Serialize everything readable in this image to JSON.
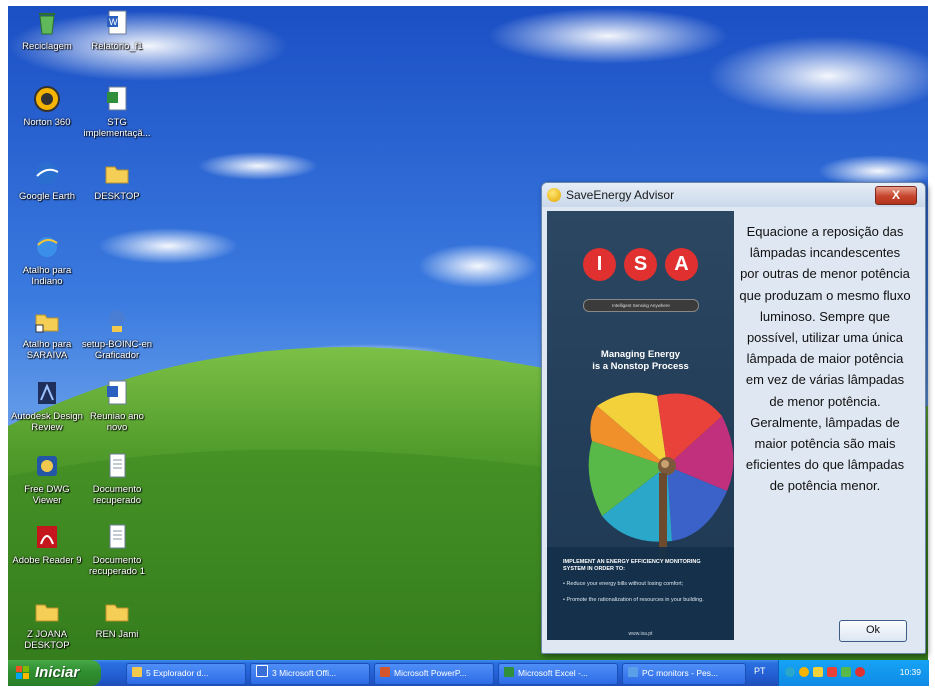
{
  "desktop": {
    "icons": [
      {
        "label": "Reciclagem",
        "icon": "recycle-bin-icon"
      },
      {
        "label": "Relatório_f1",
        "icon": "word-document-icon"
      },
      {
        "label": "Norton 360",
        "icon": "norton-icon"
      },
      {
        "label": "STG implementaçã...",
        "icon": "excel-document-icon"
      },
      {
        "label": "Google Earth",
        "icon": "google-earth-icon"
      },
      {
        "label": "DESKTOP",
        "icon": "folder-icon"
      },
      {
        "label": "Atalho para Indiano",
        "icon": "internet-explorer-icon"
      },
      {
        "label": "Atalho para SARAIVA",
        "icon": "folder-shortcut-icon"
      },
      {
        "label": "setup-BOINC-en Graficador",
        "icon": "boinc-icon"
      },
      {
        "label": "Autodesk Design Review",
        "icon": "autodesk-icon"
      },
      {
        "label": "Reuniao ano novo",
        "icon": "word-document-icon"
      },
      {
        "label": "Free DWG Viewer",
        "icon": "dwg-viewer-icon"
      },
      {
        "label": "Documento recuperado",
        "icon": "document-icon"
      },
      {
        "label": "Adobe Reader 9",
        "icon": "adobe-reader-icon"
      },
      {
        "label": "Documento recuperado 1",
        "icon": "document-icon"
      },
      {
        "label": "Z JOANA DESKTOP",
        "icon": "folder-icon"
      },
      {
        "label": "REN Jami",
        "icon": "folder-icon"
      }
    ]
  },
  "dialog": {
    "title": "SaveEnergy Advisor",
    "close_label": "X",
    "panel": {
      "logo_letters": [
        "I",
        "S",
        "A"
      ],
      "tagline": "Intelligent Sensing Anywhere",
      "headline_line1": "Managing Energy",
      "headline_line2": "is a Nonstop Process",
      "bottom_heading": "IMPLEMENT AN ENERGY EFFICIENCY MONITORING SYSTEM IN ORDER TO:",
      "bullet1": "• Reduce your energy bills without losing comfort;",
      "bullet2": "• Promote the rationalization of resources in your building.",
      "url": "www.isa.pt"
    },
    "message": "Equacione a reposição das lâmpadas incandescentes por outras de menor potência que produzam o mesmo fluxo luminoso. Sempre que possível, utilizar uma única lâmpada de maior potência em vez de várias lâmpadas de menor potência. Geralmente, lâmpadas de maior potência são mais eficientes do que lâmpadas de potência menor.",
    "ok_label": "Ok"
  },
  "taskbar": {
    "start_label": "Iniciar",
    "buttons": [
      {
        "label": "5 Explorador d...",
        "icon": "folder-icon",
        "color": "#f2c94c"
      },
      {
        "label": "3 Microsoft Offi...",
        "icon": "office-icon",
        "color": "#3a6fd8"
      },
      {
        "label": "Microsoft PowerP...",
        "icon": "powerpoint-icon",
        "color": "#d2552c"
      },
      {
        "label": "Microsoft Excel -...",
        "icon": "excel-icon",
        "color": "#2f8f3a"
      },
      {
        "label": "PC monitors - Pes...",
        "icon": "monitor-icon",
        "color": "#5aa0e8"
      }
    ],
    "language": "PT",
    "clock": "10:39"
  },
  "colors": {
    "taskbar_blue": "#245ed3",
    "start_green": "#2f8f30",
    "isa_red": "#e03030",
    "dialog_bg": "#dfe8f2"
  }
}
